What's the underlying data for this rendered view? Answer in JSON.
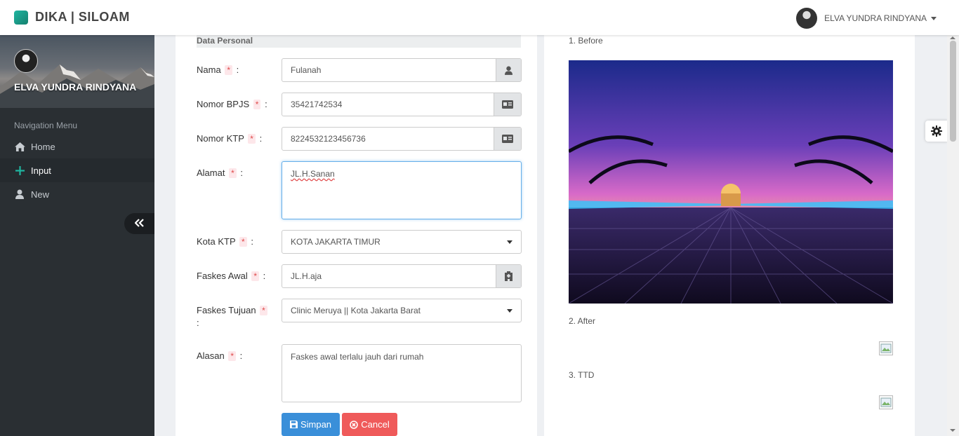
{
  "header": {
    "brand": "DIKA | SILOAM",
    "user_name": "ELVA YUNDRA RINDYANA"
  },
  "sidebar": {
    "profile_name": "ELVA YUNDRA RINDYANA",
    "nav_header": "Navigation Menu",
    "items": [
      {
        "label": "Home",
        "icon": "home-icon"
      },
      {
        "label": "Input",
        "icon": "plus-icon",
        "active": true
      },
      {
        "label": "New",
        "icon": "user-icon"
      }
    ]
  },
  "form": {
    "section_title": "Data Personal",
    "required_mark": "*",
    "colon": ":",
    "nama": {
      "label": "Nama",
      "value": "Fulanah"
    },
    "bpjs": {
      "label": "Nomor BPJS",
      "value": "35421742534"
    },
    "ktp": {
      "label": "Nomor KTP",
      "value": "8224532123456736"
    },
    "alamat": {
      "label": "Alamat",
      "value": "JL.H.Sanan"
    },
    "kota": {
      "label": "Kota KTP",
      "value": "KOTA JAKARTA TIMUR"
    },
    "faskes_awal": {
      "label": "Faskes Awal",
      "value": "JL.H.aja"
    },
    "faskes_tujuan": {
      "label": "Faskes Tujuan",
      "value": "Clinic Meruya || Kota Jakarta Barat"
    },
    "alasan": {
      "label": "Alasan",
      "value": "Faskes awal terlalu jauh dari rumah"
    },
    "save_label": "Simpan",
    "cancel_label": "Cancel"
  },
  "images": {
    "before_label": "1. Before",
    "after_label": "2. After",
    "ttd_label": "3. TTD"
  },
  "colors": {
    "sidebar_bg": "#2a2f33",
    "save": "#3a8fd9",
    "cancel": "#ef5a5a",
    "brand_accent": "#1fb5a0"
  }
}
